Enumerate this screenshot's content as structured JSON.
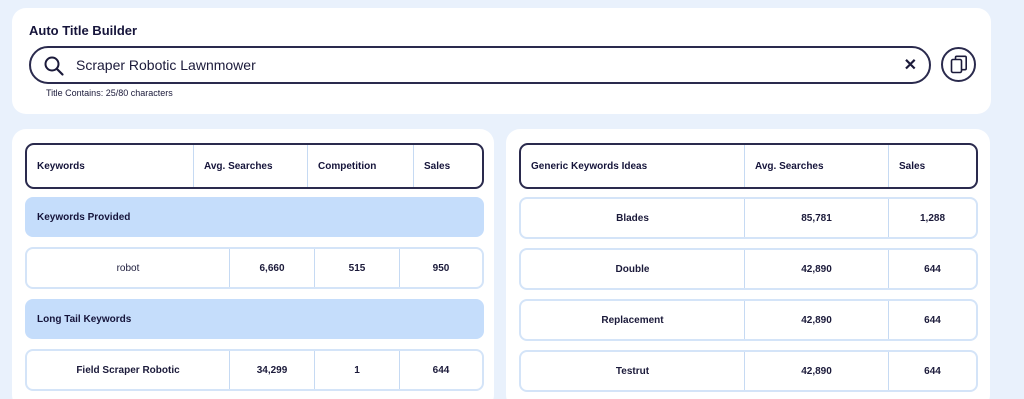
{
  "builder": {
    "title": "Auto Title Builder",
    "search_value": "Scraper Robotic Lawnmower",
    "char_count": "Title Contains: 25/80 characters",
    "clear_glyph": "✕"
  },
  "left_table": {
    "headers": [
      "Keywords",
      "Avg. Searches",
      "Competition",
      "Sales"
    ],
    "provided_label": "Keywords Provided",
    "provided_rows": [
      {
        "keyword": "robot",
        "searches": "6,660",
        "competition": "515",
        "sales": "950"
      }
    ],
    "longtail_label": "Long Tail Keywords",
    "longtail_rows": [
      {
        "keyword": "Field Scraper Robotic",
        "searches": "34,299",
        "competition": "1",
        "sales": "644"
      }
    ]
  },
  "right_table": {
    "headers": [
      "Generic Keywords Ideas",
      "Avg. Searches",
      "Sales"
    ],
    "rows": [
      {
        "keyword": "Blades",
        "searches": "85,781",
        "sales": "1,288"
      },
      {
        "keyword": "Double",
        "searches": "42,890",
        "sales": "644"
      },
      {
        "keyword": "Replacement",
        "searches": "42,890",
        "sales": "644"
      },
      {
        "keyword": "Testrut",
        "searches": "42,890",
        "sales": "644"
      }
    ]
  },
  "icons": {
    "search": "search-icon",
    "clear": "close-icon",
    "copy": "copy-icon"
  },
  "colors": {
    "page_bg": "#e9f1fc",
    "accent_section": "#c5ddfb",
    "dark_border": "#2a2a4d"
  }
}
